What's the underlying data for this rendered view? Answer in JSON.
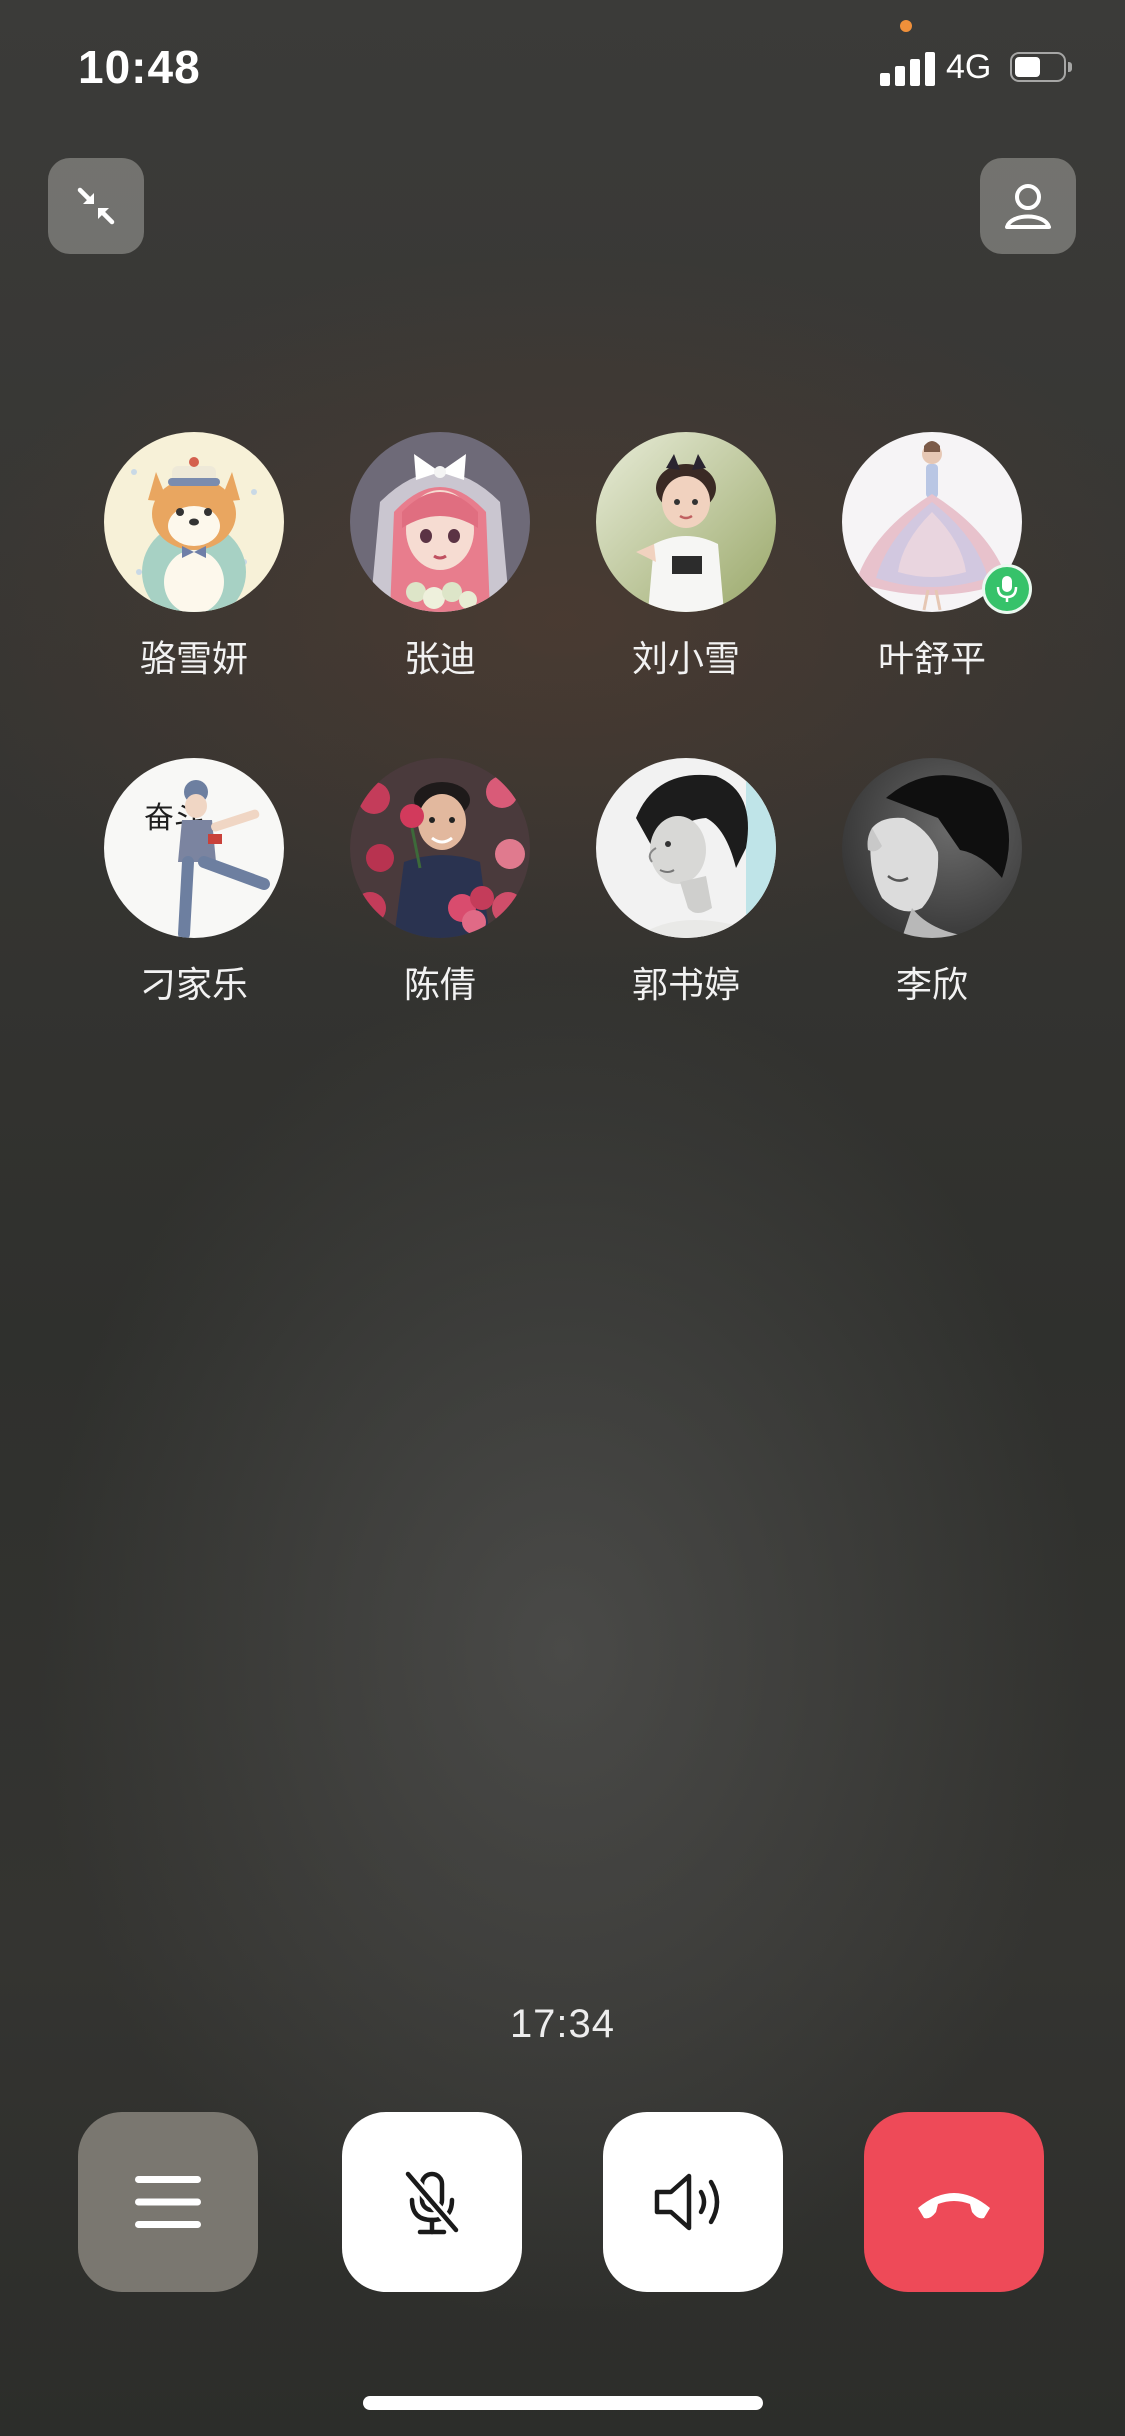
{
  "status_bar": {
    "time": "10:48",
    "network": "4G",
    "signal_bars": 4,
    "battery_level": 0.55,
    "privacy_indicator_color": "#f0903a"
  },
  "top_bar": {
    "minimize_icon": "minimize-arrows-icon",
    "add_member_icon": "person-icon"
  },
  "participants": [
    {
      "name": "骆雪妍",
      "avatar": "cartoon-corgi"
    },
    {
      "name": "张迪",
      "avatar": "anime-girl-pink-hair"
    },
    {
      "name": "刘小雪",
      "avatar": "child-photo"
    },
    {
      "name": "叶舒平",
      "avatar": "ballgown-illustration",
      "speaking": true
    },
    {
      "name": "刁家乐",
      "avatar": "dancer-illustration",
      "avatar_text": "奋斗"
    },
    {
      "name": "陈倩",
      "avatar": "man-with-roses"
    },
    {
      "name": "郭书婷",
      "avatar": "bw-portrait"
    },
    {
      "name": "李欣",
      "avatar": "bw-profile"
    }
  ],
  "call": {
    "duration": "17:34"
  },
  "controls": {
    "menu_icon": "hamburger-icon",
    "mute_icon": "mic-off-icon",
    "speaker_icon": "speaker-icon",
    "hangup_icon": "phone-hangup-icon",
    "hangup_color": "#ee4a58"
  }
}
